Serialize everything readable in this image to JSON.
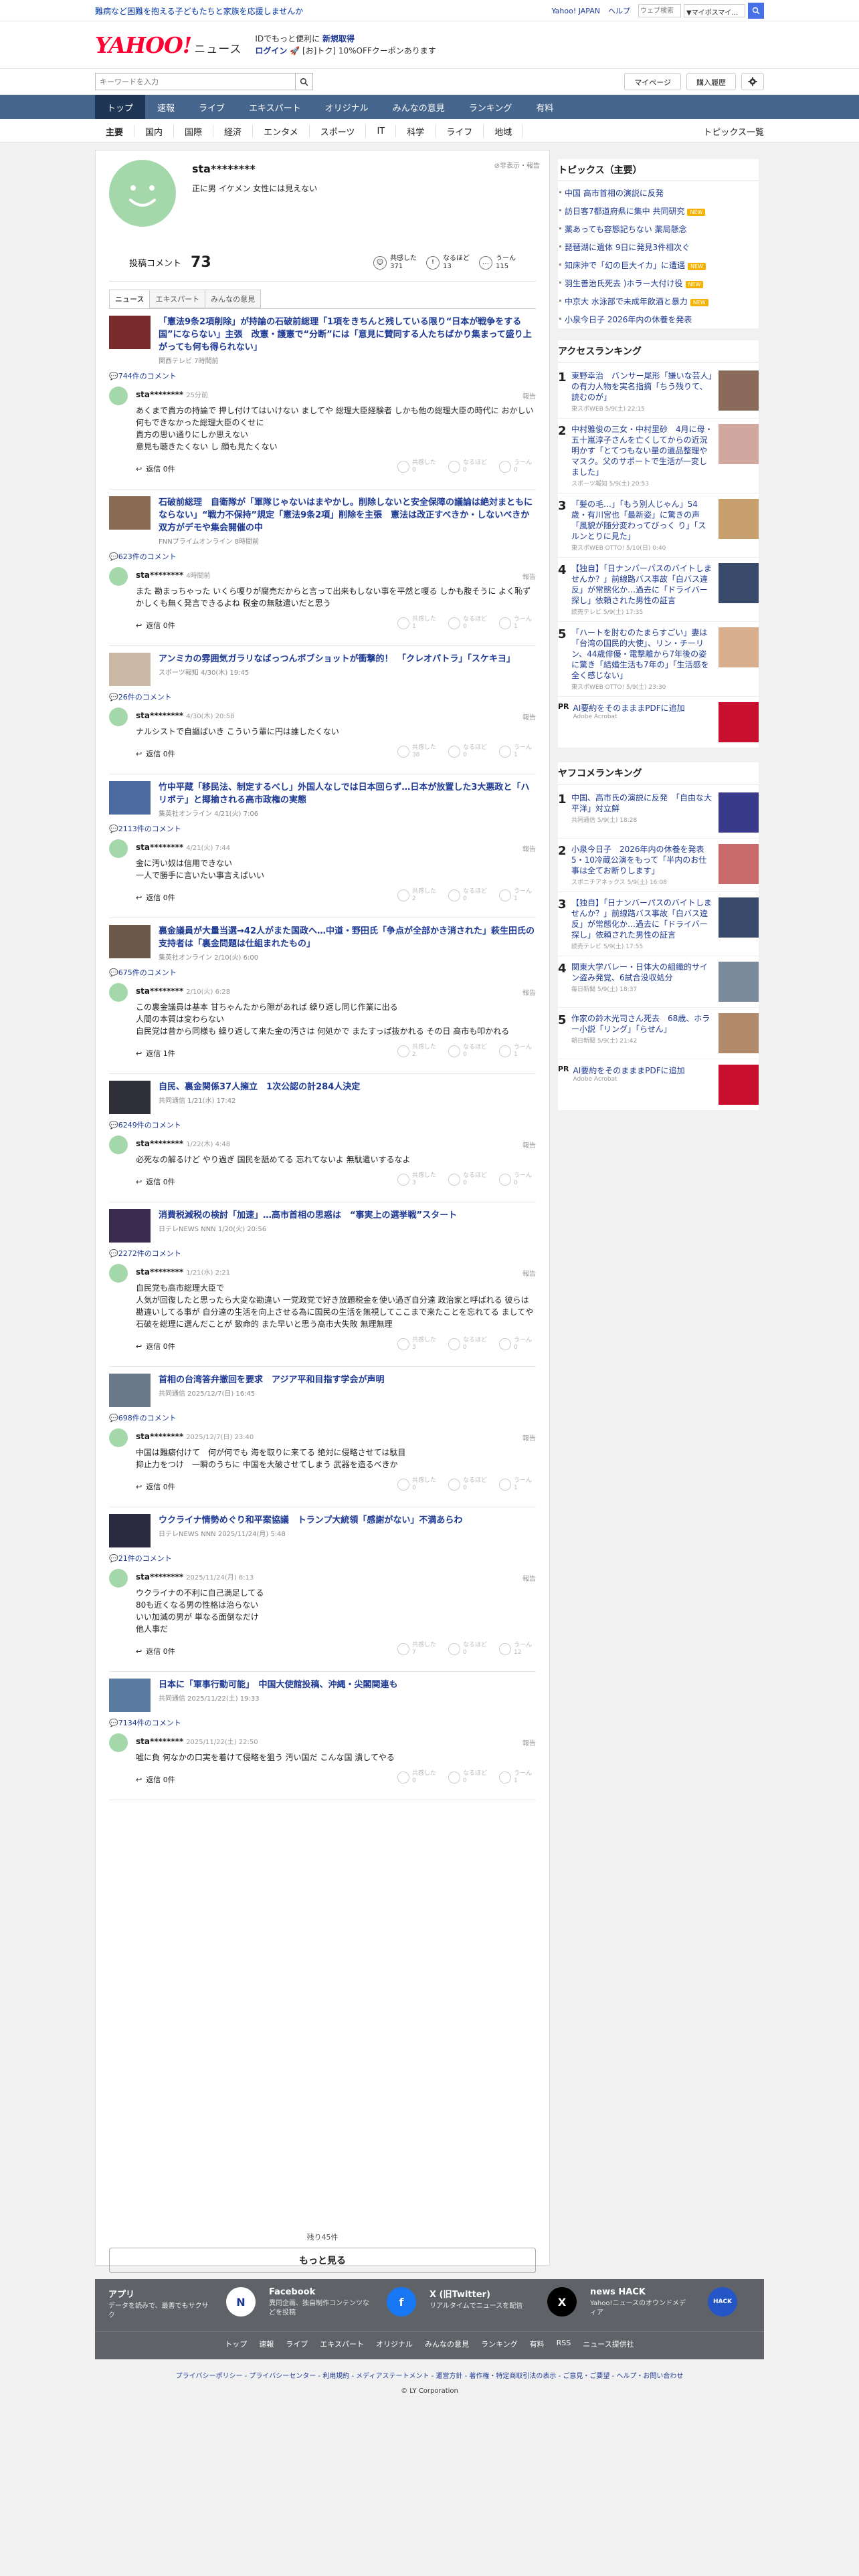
{
  "promo": {
    "text": "難病など困難を抱える子どもたちと家族を応援しませんか"
  },
  "topbar": {
    "yahoo_japan": "Yahoo! JAPAN",
    "help": "ヘルプ",
    "search_placeholder": "ウェブ検索",
    "select_value": "▼マイポスマイ..."
  },
  "header": {
    "logo": "YAHOO!",
    "logo_sub": "ニュース",
    "line1": "IDでもっと便利に",
    "new_reg": "新規取得",
    "login": "ログイン",
    "coupon": "[お]トク] 10%OFFクーポンあります"
  },
  "toolbar": {
    "search_placeholder": "キーワードを入力",
    "mypage": "マイページ",
    "purchase": "購入履歴"
  },
  "nav_primary": [
    "トップ",
    "速報",
    "ライブ",
    "エキスパート",
    "オリジナル",
    "みんなの意見",
    "ランキング",
    "有料"
  ],
  "nav_secondary": [
    "主要",
    "国内",
    "国際",
    "経済",
    "エンタメ",
    "スポーツ",
    "IT",
    "科学",
    "ライフ",
    "地域"
  ],
  "nav_secondary_more": "トピックス一覧",
  "profile": {
    "name": "sta********",
    "desc": "正に男 イケメン 女性には見えない",
    "report": "非表示・報告",
    "posts_label": "投稿コメント",
    "posts_count": "73",
    "stats": [
      {
        "label": "共感した",
        "value": "371"
      },
      {
        "label": "なるほど",
        "value": "13"
      },
      {
        "label": "うーん",
        "value": "115"
      }
    ],
    "tabs": [
      "ニュース",
      "エキスパート",
      "みんなの意見"
    ]
  },
  "comments": [
    {
      "title": "「憲法9条2項削除」が持論の石破前総理「1項をきちんと残している限り“日本が戦争をする国”にならない」主張　改憲・護憲で“分断”には「意見に賛同する人たちばかり集まって盛り上がっても何も得られない」",
      "source": "関西テレビ 7時間前",
      "count": "744件のコメント",
      "time": "25分前",
      "text": "あくまで貴方の持論で 押し付けてはいけない ましてや 総理大臣経験者 しかも他の総理大臣の時代に おかしい\n何もできなかった総理大臣のくせに\n貴方の思い通りにしか思えない\n意見も聴きたくない し 顔も見たくない",
      "replies": "返信 0件",
      "r": [
        "0",
        "0",
        "0"
      ]
    },
    {
      "title": "石破前総理　自衛隊が「軍隊じゃないはまやかし。削除しないと安全保障の議論は絶対まともにならない」“戦力不保持”規定「憲法9条2項」削除を主張　憲法は改正すべきか・しないべきか　双方がデモや集会開催の中",
      "source": "FNNプライムオンライン 8時間前",
      "count": "623件のコメント",
      "time": "4時間前",
      "text": "また 勘まっちゃった いくら嗄りが腐売だからと言って出来もしない事を平然と嗄る しかも腹そうに よく恥ずかしくも無く発言できるよね 税金の無駄遣いだと思う",
      "replies": "返信 0件",
      "r": [
        "1",
        "0",
        "1"
      ]
    },
    {
      "title": "アンミカの雰囲気ガラリなばっつんボブショットが衝撃的！　「クレオパトラ」「スケキヨ」",
      "source": "スポーツ報知 4/30(木) 19:45",
      "count": "26件のコメント",
      "time": "4/30(木) 20:58",
      "text": "ナルシストで自謳ばいき こういう輩に円は誰したくない",
      "replies": "返信 0件",
      "r": [
        "38",
        "0",
        "1"
      ]
    },
    {
      "title": "竹中平蔵「移民法、制定するべし」外国人なしでは日本回らず…日本が放置した3大悪政と「ハリボテ」と揶揄される高市政権の実態",
      "source": "集英社オンライン 4/21(火) 7:06",
      "count": "2113件のコメント",
      "time": "4/21(火) 7:44",
      "text": "金に汚い奴は信用できない\n一人で勝手に言いたい事言えばいい",
      "replies": "返信 0件",
      "r": [
        "2",
        "0",
        "1"
      ]
    },
    {
      "title": "裏金議員が大量当選→42人がまた国政へ…中道・野田氏「争点が全部かき消された」萩生田氏の支持者は「裏金問題は仕組まれたもの」",
      "source": "集英社オンライン 2/10(火) 6:00",
      "count": "675件のコメント",
      "time": "2/10(火) 6:28",
      "text": "この裏金議員は基本 甘ちゃんたから隙があれば 繰り返し同じ作業に出る\n人間の本質は変わらない\n自民党は昔から同様も 繰り返して来た金の汚さは 何処かで またすっぱ抜かれる その日 高市も叩かれる",
      "replies": "返信 1件",
      "r": [
        "2",
        "0",
        "1"
      ]
    },
    {
      "title": "自民、裏金関係37人擁立　1次公認の計284人決定",
      "source": "共同通信 1/21(水) 17:42",
      "count": "6249件のコメント",
      "time": "1/22(木) 4:48",
      "text": "必死なの解るけど やり過ぎ 国民を舐めてる 忘れてないよ 無駄遣いするなよ",
      "replies": "返信 0件",
      "r": [
        "3",
        "0",
        "0"
      ]
    },
    {
      "title": "消費税減税の検討「加速」…高市首相の思惑は　“事実上の選挙戦”スタート",
      "source": "日テレNEWS NNN 1/20(火) 20:56",
      "count": "2272件のコメント",
      "time": "1/21(水) 2:21",
      "text": "自民党も高市総理大臣で\n人気が回復したと思ったら大変な勘違い 一党政党で好き放題税金を使い過ぎ自分達 政治家と呼ばれる 彼らは勘違いしてる事が 自分達の生活を向上させる為に国民の生活を無視してここまで来たことを忘れてる ましてや石破を総理に選んだことが 致命的 また早いと思う高市大失敗 無理無理",
      "replies": "返信 0件",
      "r": [
        "3",
        "0",
        "0"
      ]
    },
    {
      "title": "首相の台湾答弁撤回を要求　アジア平和目指す学会が声明",
      "source": "共同通信 2025/12/7(日) 16:45",
      "count": "698件のコメント",
      "time": "2025/12/7(日) 23:40",
      "text": "中国は難癖付けて　何が何でも 海を取りに来てる 絶対に侵略させては駄目\n抑止力をつけ　一瞬のうちに 中国を大破させてしまう 武器を造るべきか",
      "replies": "返信 0件",
      "r": [
        "0",
        "0",
        "1"
      ]
    },
    {
      "title": "ウクライナ情勢めぐり和平案協議　トランプ大統領「感謝がない」不満あらわ",
      "source": "日テレNEWS NNN 2025/11/24(月) 5:48",
      "count": "21件のコメント",
      "time": "2025/11/24(月) 6:13",
      "text": "ウクライナの不利に自己満足してる\n80も近くなる男の性格は治らない\nいい加減の男が 単なる面倒なだけ\n他人事だ",
      "replies": "返信 0件",
      "r": [
        "7",
        "0",
        "12"
      ]
    },
    {
      "title": "日本に「軍事行動可能」　中国大使館投稿、沖縄・尖閣関連も",
      "source": "共同通信 2025/11/22(土) 19:33",
      "count": "7134件のコメント",
      "time": "2025/11/22(土) 22:50",
      "text": "嘘に負 何なかの口実を着けて侵略を狙う 汚い国だ こんな国 潰してやる",
      "replies": "返信 0件",
      "r": [
        "0",
        "0",
        "1"
      ]
    }
  ],
  "reaction_labels": [
    "共感した",
    "なるほど",
    "うーん"
  ],
  "report_label": "報告",
  "remaining": "残り45件",
  "more_button": "もっと見る",
  "sidebar": {
    "topics_title": "トピックス（主要）",
    "topics": [
      {
        "t": "中国 高市首相の演説に反発",
        "new": false
      },
      {
        "t": "訪日客7都道府県に集中 共同研究",
        "new": true
      },
      {
        "t": "薬あっても容態記ちない 薬局懸念",
        "new": false
      },
      {
        "t": "琵琶湖に遺体 9日に発見3件相次ぐ",
        "new": false
      },
      {
        "t": "知床沖で「幻の巨大イカ」に遭遇",
        "new": true
      },
      {
        "t": "羽生善治氏死去 )ホラー大付け役",
        "new": true
      },
      {
        "t": "中京大 水泳部で未成年飲酒と暴力",
        "new": true
      },
      {
        "t": "小泉今日子 2026年内の休養を発表",
        "new": false
      }
    ],
    "new_label": "NEW",
    "access_title": "アクセスランキング",
    "access": [
      {
        "t": "東野幸治　バンサー尾形「嫌いな芸人」の有力人物を実名指摘「ちう残りて、読むのが」",
        "s": "東スポWEB 5/9(土) 22:15"
      },
      {
        "t": "中村雅俊の三女・中村里砂　4月に母・五十嵐淳子さんを亡くしてからの近況明かす「とてつもない量の遺品整理やマスク。父のサポートで生活が一変しました」",
        "s": "スポーツ報知 5/9(土) 20:53"
      },
      {
        "t": "「髪の毛…」「もう別人じゃん」54歳・有川宮也「最新姿」に驚きの声「風貌が随分変わってびっく り」「スルンとりに見た」",
        "s": "東スポWEB OTTO! 5/10(日) 0:40"
      },
      {
        "t": "【独自】「日ナンバーパスのバイトしませんか？」前線路バス事故「白バス違反」が常態化か…過去に「ドライバー探し」依頼された男性の証言",
        "s": "読売テレビ 5/9(土) 17:35"
      },
      {
        "t": "「ハートを肘むのたまらすごい」妻は「台湾の国民的大使」、リン・チーリン、44歳俳優・電撃離から7年後の姿に驚き「結婚生活も7年の」「生活感を全く感じない」",
        "s": "東スポWEB OTTO! 5/9(土) 23:30"
      }
    ],
    "pr1": {
      "label": "PR",
      "t": "AI要約をそのまままPDFに追加",
      "s": "Adobe Acrobat"
    },
    "yafoo_title": "ヤフコメランキング",
    "yafoo": [
      {
        "t": "中国、高市氏の演説に反発　「自由な大平洋」対立鮮",
        "s": "共同通信 5/9(土) 18:28"
      },
      {
        "t": "小泉今日子　2026年内の休養を発表　5・10冷蔵公演をもって「半内のお仕事は全てお断りします」",
        "s": "スポニチアネックス 5/9(土) 16:08"
      },
      {
        "t": "【独自】「日ナンバーパスのバイトしませんか？」前線路バス事故「白バス違反」が常態化か…過去に「ドライバー探し」依頼された男性の証言",
        "s": "読売テレビ 5/9(土) 17:55"
      },
      {
        "t": "関東大学バレー・日体大の組織的サイン盗み発覚、6試合没収処分",
        "s": "毎日新聞 5/9(土) 18:37"
      },
      {
        "t": "作家の鈴木光司さん死去　68歳、ホラー小説「リング」「らせん」",
        "s": "朝日新聞 5/9(土) 21:42"
      }
    ],
    "pr2": {
      "label": "PR",
      "t": "AI要約をそのまままPDFに追加",
      "s": "Adobe Acrobat"
    }
  },
  "footer": {
    "apps": [
      {
        "name": "アプリ",
        "desc": "データを読みで、最善でもサクサク"
      },
      {
        "name": "Facebook",
        "desc": "異同企画、独自制作コンテンツなどを投稿"
      },
      {
        "name": "X (旧Twitter)",
        "desc": "リアルタイムでニュースを配信"
      },
      {
        "name": "news HACK",
        "desc": "Yahoo!ニュースのオウンドメディア"
      }
    ],
    "links": [
      "トップ",
      "速報",
      "ライブ",
      "エキスパート",
      "オリジナル",
      "みんなの意見",
      "ランキング",
      "有料",
      "RSS",
      "ニュース提供社"
    ],
    "policy": "プライバシーポリシー - プライバシーセンター - 利用規約 - メディアステートメント - 運営方針 - 著作権・特定商取引法の表示 - ご意見・ご要望 - ヘルプ・お問い合わせ",
    "copyright": "© LY Corporation"
  }
}
